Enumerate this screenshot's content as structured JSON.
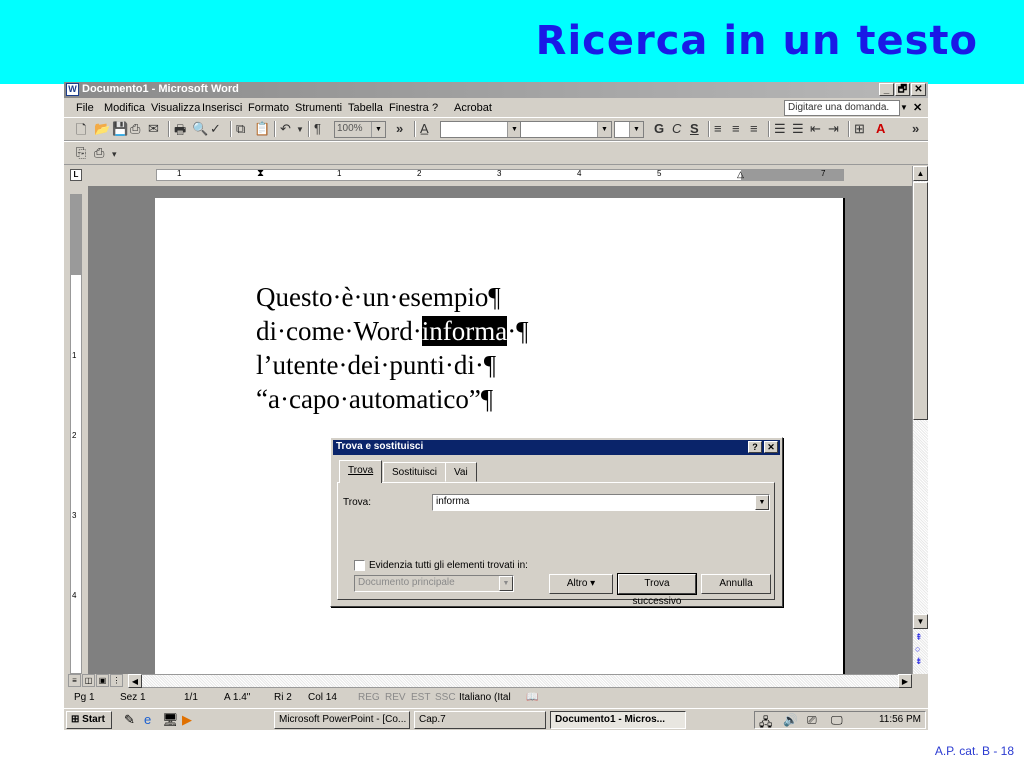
{
  "slide": {
    "title": "Ricerca in un testo",
    "footer": "A.P. cat. B - 18"
  },
  "window": {
    "title": "Documento1 - Microsoft Word",
    "minimize": "_",
    "restore": "🗗",
    "close": "✕"
  },
  "menu": {
    "items": [
      "File",
      "Modifica",
      "Visualizza",
      "Inserisci",
      "Formato",
      "Strumenti",
      "Tabella",
      "Finestra",
      "?",
      "Acrobat"
    ],
    "ask_placeholder": "Digitare una domanda.",
    "close": "✕"
  },
  "toolbar": {
    "zoom": "100%",
    "bold": "G",
    "italic": "C",
    "underline": "S"
  },
  "ruler": {
    "h_numbers": [
      "1",
      "1",
      "2",
      "3",
      "4",
      "5",
      "7"
    ],
    "v_numbers": [
      "1",
      "2",
      "3",
      "4"
    ]
  },
  "document": {
    "line1": "Questo·è·un·esempio¶",
    "line2_before": "di·come·Word·",
    "line2_highlight": "informa",
    "line2_after": "·¶",
    "line3": "l’utente·dei·punti·di·¶",
    "line4": "“a·capo·automatico”¶"
  },
  "dialog": {
    "title": "Trova e sostituisci",
    "help": "?",
    "close": "✕",
    "tabs": [
      "Trova",
      "Sostituisci",
      "Vai"
    ],
    "find_label": "Trova:",
    "find_value": "informa",
    "highlight_label": "Evidenzia tutti gli elementi trovati in:",
    "scope_value": "Documento principale",
    "more_button": "Altro ▾",
    "find_next_button": "Trova successivo",
    "cancel_button": "Annulla"
  },
  "statusbar": {
    "page": "Pg 1",
    "section": "Sez 1",
    "pages": "1/1",
    "at": "A 1.4\"",
    "line": "Ri 2",
    "col": "Col 14",
    "rec": "REG",
    "rev": "REV",
    "ext": "EST",
    "ovr": "SSC",
    "language": "Italiano (Ital"
  },
  "taskbar": {
    "start": "Start",
    "tasks": [
      "Microsoft PowerPoint - [Co...",
      "Cap.7",
      "Documento1 - Micros..."
    ],
    "clock": "11:56 PM"
  }
}
